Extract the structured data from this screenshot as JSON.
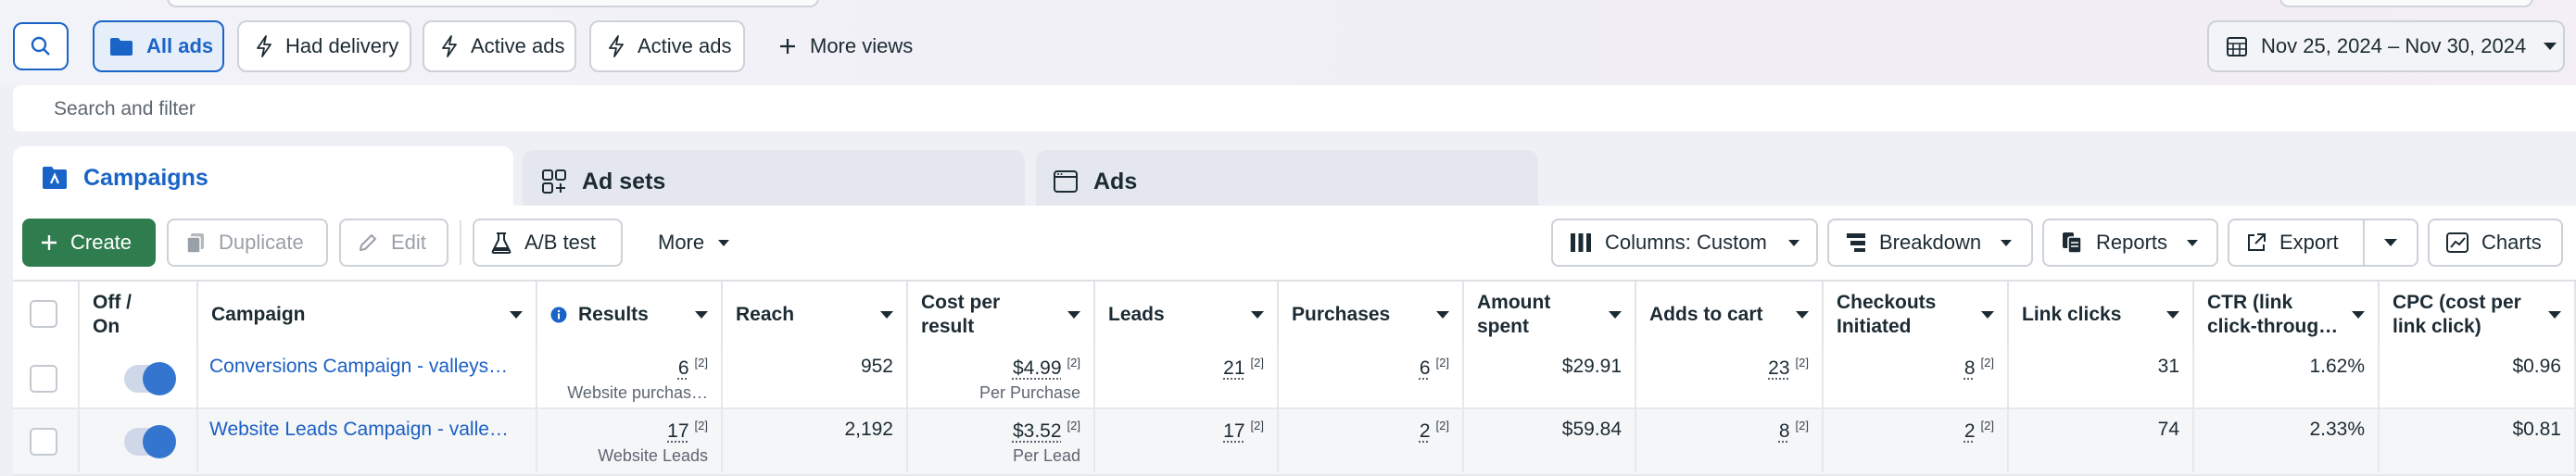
{
  "views": {
    "all_ads": "All ads",
    "had_delivery": "Had delivery",
    "active_ads_1": "Active ads",
    "active_ads_2": "Active ads",
    "more_views": "More views"
  },
  "date_range": "Nov 25, 2024 – Nov 30, 2024",
  "search": {
    "placeholder": "Search and filter"
  },
  "tabs": {
    "campaigns": "Campaigns",
    "ad_sets": "Ad sets",
    "ads": "Ads"
  },
  "toolbar": {
    "create": "Create",
    "duplicate": "Duplicate",
    "edit": "Edit",
    "ab_test": "A/B test",
    "more": "More",
    "columns": "Columns: Custom",
    "breakdown": "Breakdown",
    "reports": "Reports",
    "export": "Export",
    "charts": "Charts"
  },
  "columns": {
    "off_on": [
      "Off /",
      "On"
    ],
    "campaign": "Campaign",
    "results": "Results",
    "reach": "Reach",
    "cost_per_result": [
      "Cost per",
      "result"
    ],
    "leads": "Leads",
    "purchases": "Purchases",
    "amount_spent": [
      "Amount",
      "spent"
    ],
    "adds_to_cart": "Adds to cart",
    "checkouts": [
      "Checkouts",
      "Initiated"
    ],
    "link_clicks": "Link clicks",
    "ctr": [
      "CTR (link",
      "click-throug…"
    ],
    "cpc": [
      "CPC (cost per",
      "link click)"
    ]
  },
  "rows": [
    {
      "enabled": true,
      "campaign": "Conversions Campaign - valleys…",
      "results": "6",
      "results_sup": "[2]",
      "results_sub": "Website purchas…",
      "reach": "952",
      "cost_per_result": "$4.99",
      "cost_sup": "[2]",
      "cost_sub": "Per Purchase",
      "leads": "21",
      "leads_sup": "[2]",
      "purchases": "6",
      "purchases_sup": "[2]",
      "amount_spent": "$29.91",
      "adds_to_cart": "23",
      "adds_sup": "[2]",
      "checkouts": "8",
      "checkouts_sup": "[2]",
      "link_clicks": "31",
      "ctr": "1.62%",
      "cpc": "$0.96"
    },
    {
      "enabled": true,
      "campaign": "Website Leads Campaign - valle…",
      "results": "17",
      "results_sup": "[2]",
      "results_sub": "Website Leads",
      "reach": "2,192",
      "cost_per_result": "$3.52",
      "cost_sup": "[2]",
      "cost_sub": "Per Lead",
      "leads": "17",
      "leads_sup": "[2]",
      "purchases": "2",
      "purchases_sup": "[2]",
      "amount_spent": "$59.84",
      "adds_to_cart": "8",
      "adds_sup": "[2]",
      "checkouts": "2",
      "checkouts_sup": "[2]",
      "link_clicks": "74",
      "ctr": "2.33%",
      "cpc": "$0.81"
    }
  ],
  "colors": {
    "accent": "#1a64c8",
    "create": "#2f7d4f",
    "toggle": "#3476cf"
  },
  "icons": [
    "search-icon",
    "folder-icon",
    "lightning-icon",
    "plus-icon",
    "calendar-icon",
    "campaign-icon",
    "adsets-icon",
    "ads-icon",
    "duplicate-icon",
    "edit-icon",
    "flask-icon",
    "columns-icon",
    "breakdown-icon",
    "reports-icon",
    "export-icon",
    "charts-icon",
    "info-icon"
  ]
}
